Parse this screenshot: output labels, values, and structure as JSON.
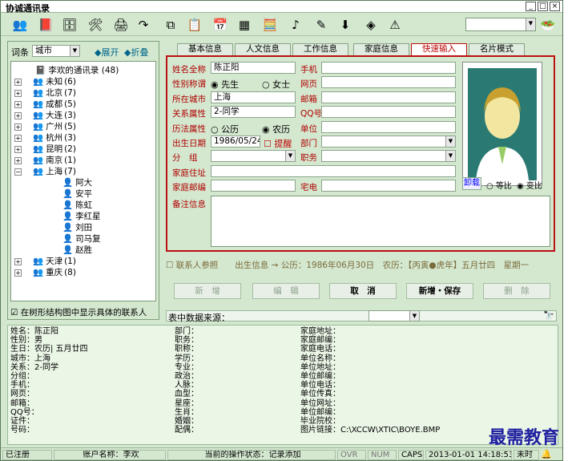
{
  "app": {
    "title": "协诚通讯录"
  },
  "toolbar": {
    "icons": [
      "people-icon",
      "book-icon",
      "cabinet-icon",
      "tools-icon",
      "printer-icon",
      "redo-icon",
      "copy-icon",
      "paste-icon",
      "calendar-icon",
      "grid-icon",
      "calculator-icon",
      "music-icon",
      "pen-icon",
      "download-icon",
      "sign-icon",
      "warning-icon"
    ]
  },
  "sidebar": {
    "filter_label": "词条",
    "filter_value": "城市",
    "expand": "◆展开",
    "collapse": "◆折叠",
    "root": "李欢的通讯录 (48)",
    "cities": [
      {
        "name": "未知",
        "count": "(6)"
      },
      {
        "name": "北京",
        "count": "(7)"
      },
      {
        "name": "成都",
        "count": "(5)"
      },
      {
        "name": "大连",
        "count": "(3)"
      },
      {
        "name": "广州",
        "count": "(5)"
      },
      {
        "name": "杭州",
        "count": "(3)"
      },
      {
        "name": "昆明",
        "count": "(2)"
      },
      {
        "name": "南京",
        "count": "(1)"
      },
      {
        "name": "上海",
        "count": "(7)"
      }
    ],
    "shanghai": [
      "阿大",
      "安平",
      "陈虹",
      "李红星",
      "刘田",
      "司马复",
      "赵胜"
    ],
    "tail": [
      {
        "name": "天津",
        "count": "(1)"
      },
      {
        "name": "重庆",
        "count": "(8)"
      }
    ],
    "show_contacts": "在树形结构图中显示具体的联系人"
  },
  "tabs": [
    "基本信息",
    "人文信息",
    "工作信息",
    "家庭信息",
    "快速输入",
    "名片模式"
  ],
  "form": {
    "name_l": "姓名全称",
    "name": "陈正阳",
    "title_l": "性别称谓",
    "male": "先生",
    "female": "女士",
    "city_l": "所在城市",
    "city": "上海",
    "rel_l": "关系属性",
    "rel": "2-同学",
    "cal_l": "历法属性",
    "cal_g": "公历",
    "cal_n": "农历",
    "birth_l": "出生日期",
    "birth": "1986/05/24",
    "remind": "提醒",
    "group_l": "分　组",
    "home_addr_l": "家庭住址",
    "home_zip_l": "家庭邮编",
    "mobile_l": "手机",
    "web_l": "网页",
    "mail_l": "邮箱",
    "qq_l": "QQ号",
    "unit_l": "单位",
    "dept_l": "部门",
    "job_l": "职务",
    "home_tel_l": "宅电",
    "note_l": "备注信息",
    "unload": "卸载",
    "eq": "等比",
    "var": "变比"
  },
  "birthinfo": {
    "check": "联系人参照",
    "text": "出生信息 → 公历：1986年06月30日　农历：【丙寅●虎年】五月廿四　星期一"
  },
  "buttons": {
    "add": "新　增",
    "edit": "编　辑",
    "cancel": "取　消",
    "add_save": "新增・保存",
    "del": "删　除"
  },
  "source": {
    "label": "表中数据来源："
  },
  "details": {
    "c1": [
      "姓名：陈正阳",
      "性别：男",
      "生日：农历| 五月廿四",
      "城市：上海",
      "关系：2-同学",
      "分组：",
      "手机：",
      "网页：",
      "邮箱：",
      "QQ号：",
      "证件：",
      "号码："
    ],
    "c2": [
      "部门：",
      "职务：",
      "职称：",
      "学历：",
      "专业：",
      "政治：",
      "人脉：",
      "血型：",
      "星座：",
      "生肖：",
      "婚姻：",
      "配偶："
    ],
    "c3": [
      "家庭地址：",
      "家庭邮编：",
      "家庭电话：",
      "单位名称：",
      "单位地址：",
      "单位邮编：",
      "单位电话：",
      "单位传真：",
      "单位网址：",
      "单位邮编：",
      "毕业院校：",
      "图片链接：C:\\XCCW\\XTIC\\BOYE.BMP"
    ]
  },
  "status": {
    "reg": "已注册",
    "account": "账户名称：李欢",
    "state": "当前的操作状态：记录添加",
    "ovr": "OVR",
    "num": "NUM",
    "caps": "CAPS",
    "datetime": "2013-01-01 14:18:53",
    "tail": "未时"
  },
  "watermark": "最需教育"
}
